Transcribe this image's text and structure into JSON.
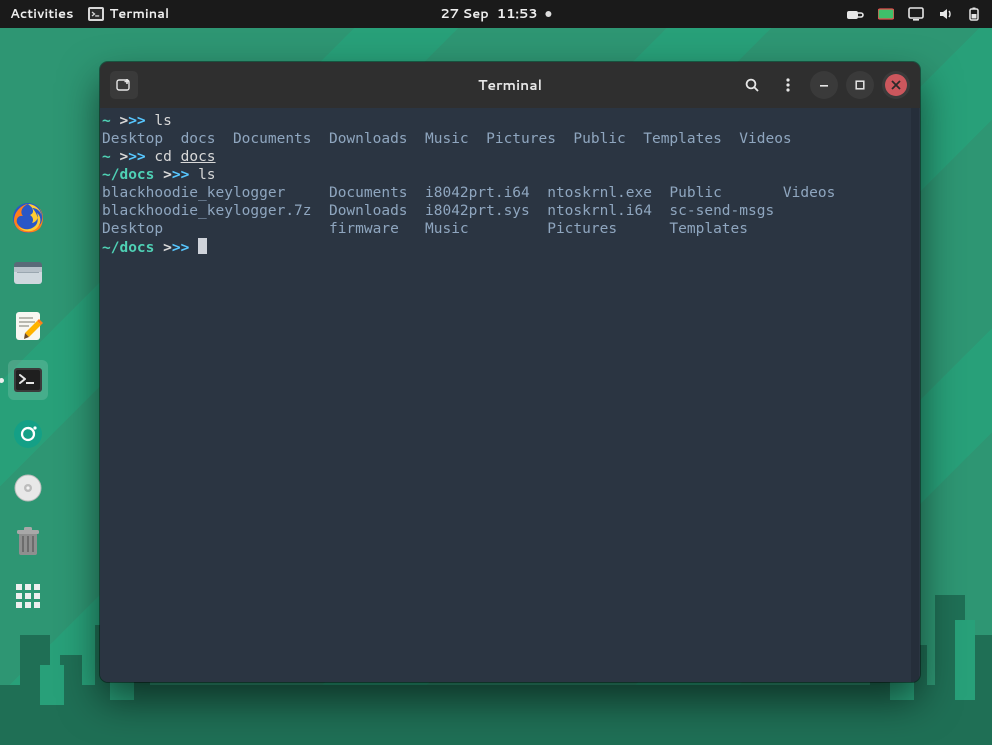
{
  "topbar": {
    "activities": "Activities",
    "app_name": "Terminal",
    "date": "27 Sep",
    "time": "11:53"
  },
  "dock": {
    "items": [
      {
        "name": "firefox-icon"
      },
      {
        "name": "files-icon"
      },
      {
        "name": "text-editor-icon"
      },
      {
        "name": "terminal-icon",
        "active": true
      },
      {
        "name": "screenshot-icon"
      },
      {
        "name": "disc-icon"
      },
      {
        "name": "trash-icon"
      },
      {
        "name": "apps-grid-icon"
      }
    ]
  },
  "window": {
    "title": "Terminal"
  },
  "terminal": {
    "prompts": {
      "p1": {
        "path": "~",
        "sym1": ">",
        "sym2": ">>"
      },
      "p2": {
        "path": "~",
        "sym1": ">",
        "sym2": ">>"
      },
      "p3": {
        "path": "~/docs",
        "sym1": ">",
        "sym2": ">>"
      },
      "p4": {
        "path": "~/docs",
        "sym1": ">",
        "sym2": ">>"
      }
    },
    "commands": {
      "c1": "ls",
      "c2_cmd": "cd",
      "c2_arg": "docs",
      "c3": "ls"
    },
    "ls1": "Desktop  docs  Documents  Downloads  Music  Pictures  Public  Templates  Videos",
    "ls2_rows": [
      "blackhoodie_keylogger     Documents  i8042prt.i64  ntoskrnl.exe  Public       Videos",
      "blackhoodie_keylogger.7z  Downloads  i8042prt.sys  ntoskrnl.i64  sc-send-msgs",
      "Desktop                   firmware   Music         Pictures      Templates"
    ],
    "ls2_files": [
      "blackhoodie_keylogger",
      "blackhoodie_keylogger.7z",
      "Desktop",
      "Documents",
      "Downloads",
      "firmware",
      "i8042prt.i64",
      "i8042prt.sys",
      "Music",
      "ntoskrnl.exe",
      "ntoskrnl.i64",
      "Pictures",
      "Public",
      "sc-send-msgs",
      "Templates",
      "Videos"
    ]
  },
  "colors": {
    "teal": "#4fd1b5",
    "blue": "#57c7ff",
    "bg": "#2b3542",
    "topbar": "#1a1a1a",
    "close": "#cc575d"
  }
}
